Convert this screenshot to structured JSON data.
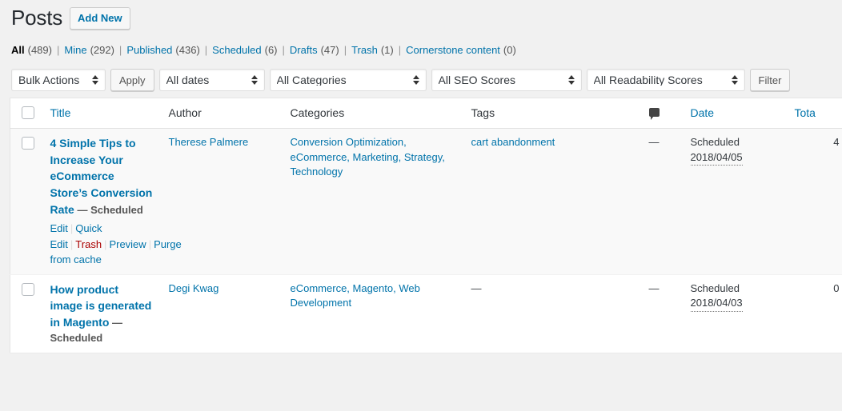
{
  "header": {
    "title": "Posts",
    "add_new_label": "Add New"
  },
  "status_nav": [
    {
      "label": "All",
      "count": "(489)",
      "current": true
    },
    {
      "label": "Mine",
      "count": "(292)",
      "current": false
    },
    {
      "label": "Published",
      "count": "(436)",
      "current": false
    },
    {
      "label": "Scheduled",
      "count": "(6)",
      "current": false
    },
    {
      "label": "Drafts",
      "count": "(47)",
      "current": false
    },
    {
      "label": "Trash",
      "count": "(1)",
      "current": false
    },
    {
      "label": "Cornerstone content",
      "count": "(0)",
      "current": false
    }
  ],
  "toolbar": {
    "bulk_actions": "Bulk Actions",
    "apply_label": "Apply",
    "all_dates": "All dates",
    "all_categories": "All Categories",
    "all_seo_scores": "All SEO Scores",
    "all_readability_scores": "All Readability Scores",
    "filter_label": "Filter"
  },
  "table": {
    "columns": {
      "title": "Title",
      "author": "Author",
      "categories": "Categories",
      "tags": "Tags",
      "comments_icon": "comment-bubble-icon",
      "date": "Date",
      "total": "Tota"
    },
    "rows": [
      {
        "title": "4 Simple Tips to Increase Your eCommerce Store’s Conversion Rate",
        "state": "— Scheduled",
        "actions": {
          "edit": "Edit",
          "quick_edit": "Quick Edit",
          "trash": "Trash",
          "preview": "Preview",
          "purge": "Purge from cache"
        },
        "author": "Therese Palmere",
        "categories": "Conversion Optimization, eCommerce, Marketing, Strategy, Technology",
        "tags": "cart abandonment",
        "comments": "—",
        "date_status": "Scheduled",
        "date_value": "2018/04/05",
        "total": "4"
      },
      {
        "title": "How product image is generated in Magento",
        "state": "— Scheduled",
        "actions": null,
        "author": "Degi Kwag",
        "categories": "eCommerce, Magento, Web Development",
        "tags": "—",
        "comments": "—",
        "date_status": "Scheduled",
        "date_value": "2018/04/03",
        "total": "0"
      }
    ]
  },
  "colors": {
    "link": "#0073aa",
    "trash_link": "#a00",
    "page_bg": "#f1f1f1",
    "table_bg": "#ffffff"
  }
}
